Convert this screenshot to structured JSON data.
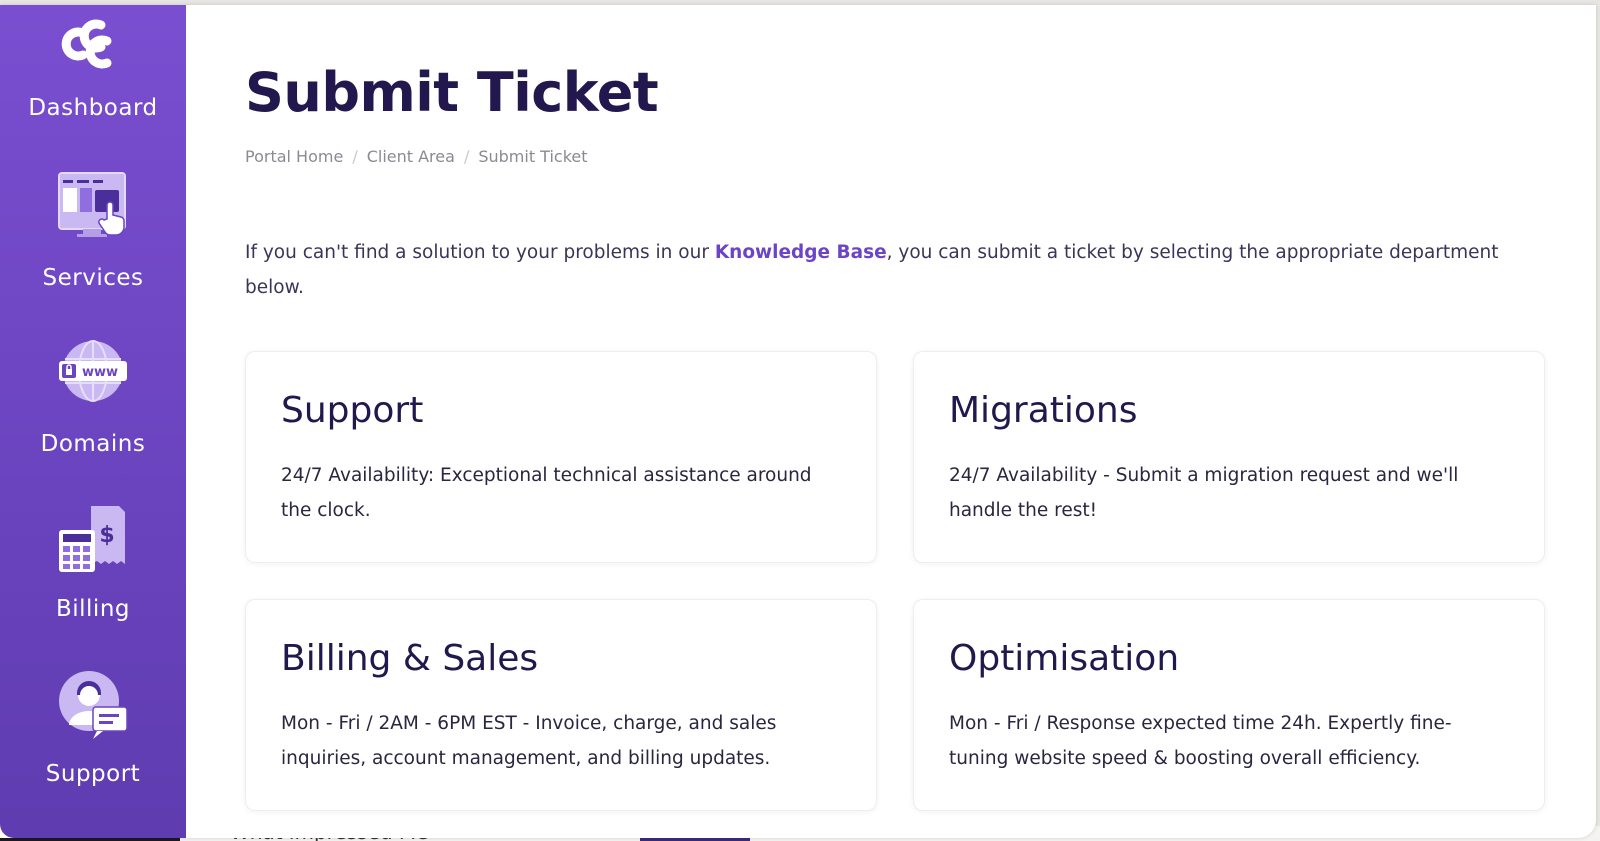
{
  "sidebar": {
    "items": [
      {
        "label": "Dashboard",
        "icon": "ccc-logo-icon"
      },
      {
        "label": "Services",
        "icon": "services-icon"
      },
      {
        "label": "Domains",
        "icon": "domain-globe-icon"
      },
      {
        "label": "Billing",
        "icon": "billing-calculator-icon"
      },
      {
        "label": "Support",
        "icon": "support-agent-icon"
      }
    ],
    "domains_icon_text": "www",
    "billing_icon_text": "$"
  },
  "page": {
    "title": "Submit Ticket",
    "breadcrumb": [
      "Portal Home",
      "Client Area",
      "Submit Ticket"
    ],
    "intro_before": "If you can't find a solution to your problems in our ",
    "intro_link": "Knowledge Base",
    "intro_after": ", you can submit a ticket by selecting the appropriate department below."
  },
  "departments": [
    {
      "title": "Support",
      "desc": "24/7 Availability: Exceptional technical assistance around the clock."
    },
    {
      "title": "Migrations",
      "desc": "24/7 Availability - Submit a migration request and we'll handle the rest!"
    },
    {
      "title": "Billing & Sales",
      "desc": "Mon - Fri / 2AM - 6PM EST - Invoice, charge, and sales inquiries, account management, and billing updates."
    },
    {
      "title": "Optimisation",
      "desc": "Mon - Fri / Response expected time 24h. Expertly fine-tuning website speed & boosting overall efficiency."
    }
  ],
  "background_peek_text": "What impressed Me",
  "colors": {
    "sidebar": "#6b44c0",
    "title": "#22184d",
    "link": "#6c44c8"
  }
}
